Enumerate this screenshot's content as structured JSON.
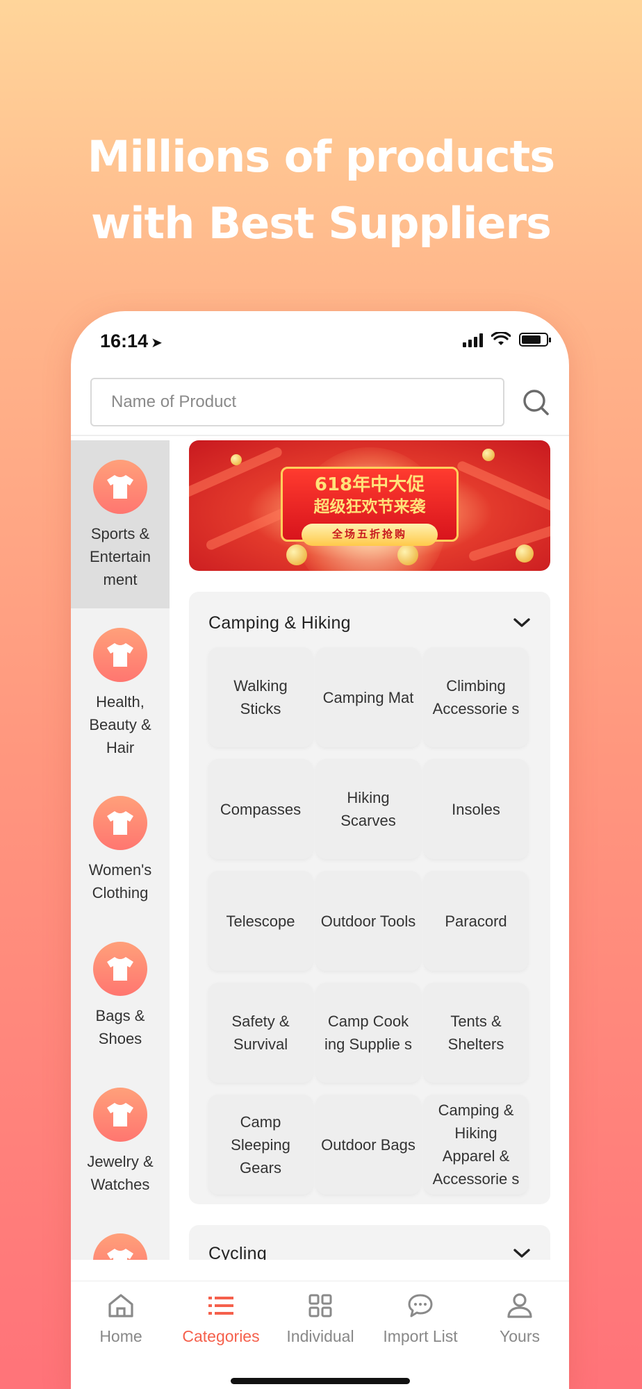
{
  "promo": {
    "headline_line1": "Millions of products",
    "headline_line2": "with Best Suppliers"
  },
  "status_bar": {
    "time": "16:14"
  },
  "search": {
    "placeholder": "Name of Product",
    "value": ""
  },
  "sidebar": {
    "active_index": 0,
    "items": [
      {
        "label": "Sports & Entertain ment",
        "icon": "tshirt-icon"
      },
      {
        "label": "Health, Beauty & Hair",
        "icon": "tshirt-icon"
      },
      {
        "label": "Women's Clothing",
        "icon": "tshirt-icon"
      },
      {
        "label": "Bags & Shoes",
        "icon": "tshirt-icon"
      },
      {
        "label": "Jewelry & Watches",
        "icon": "tshirt-icon"
      },
      {
        "label": "",
        "icon": "tshirt-icon"
      }
    ]
  },
  "banner": {
    "title_line1": "618年中大促",
    "title_line2": "超级狂欢节来袭",
    "subtitle": "全场五折抢购"
  },
  "sections": [
    {
      "title": "Camping & Hiking",
      "items": [
        "Walking Sticks",
        "Camping Mat",
        "Climbing Accessorie s",
        "Compasses",
        "Hiking Scarves",
        "Insoles",
        "Telescope",
        "Outdoor Tools",
        "Paracord",
        "Safety & Survival",
        "Camp Cook ing Supplie s",
        "Tents & Shelters",
        "Camp Sleeping Gears",
        "Outdoor Bags",
        "Camping & Hiking Apparel & Accessorie s"
      ]
    },
    {
      "title": "Cycling"
    }
  ],
  "tabbar": {
    "active_index": 1,
    "tabs": [
      {
        "label": "Home",
        "icon": "home-icon"
      },
      {
        "label": "Categories",
        "icon": "list-icon"
      },
      {
        "label": "Individual",
        "icon": "grid-icon"
      },
      {
        "label": "Import List",
        "icon": "chat-icon"
      },
      {
        "label": "Yours",
        "icon": "user-icon"
      }
    ]
  },
  "colors": {
    "accent": "#F5604C",
    "background_top": "#FFD59A",
    "background_bottom": "#FF7379",
    "category_icon": "#FF8A75"
  }
}
